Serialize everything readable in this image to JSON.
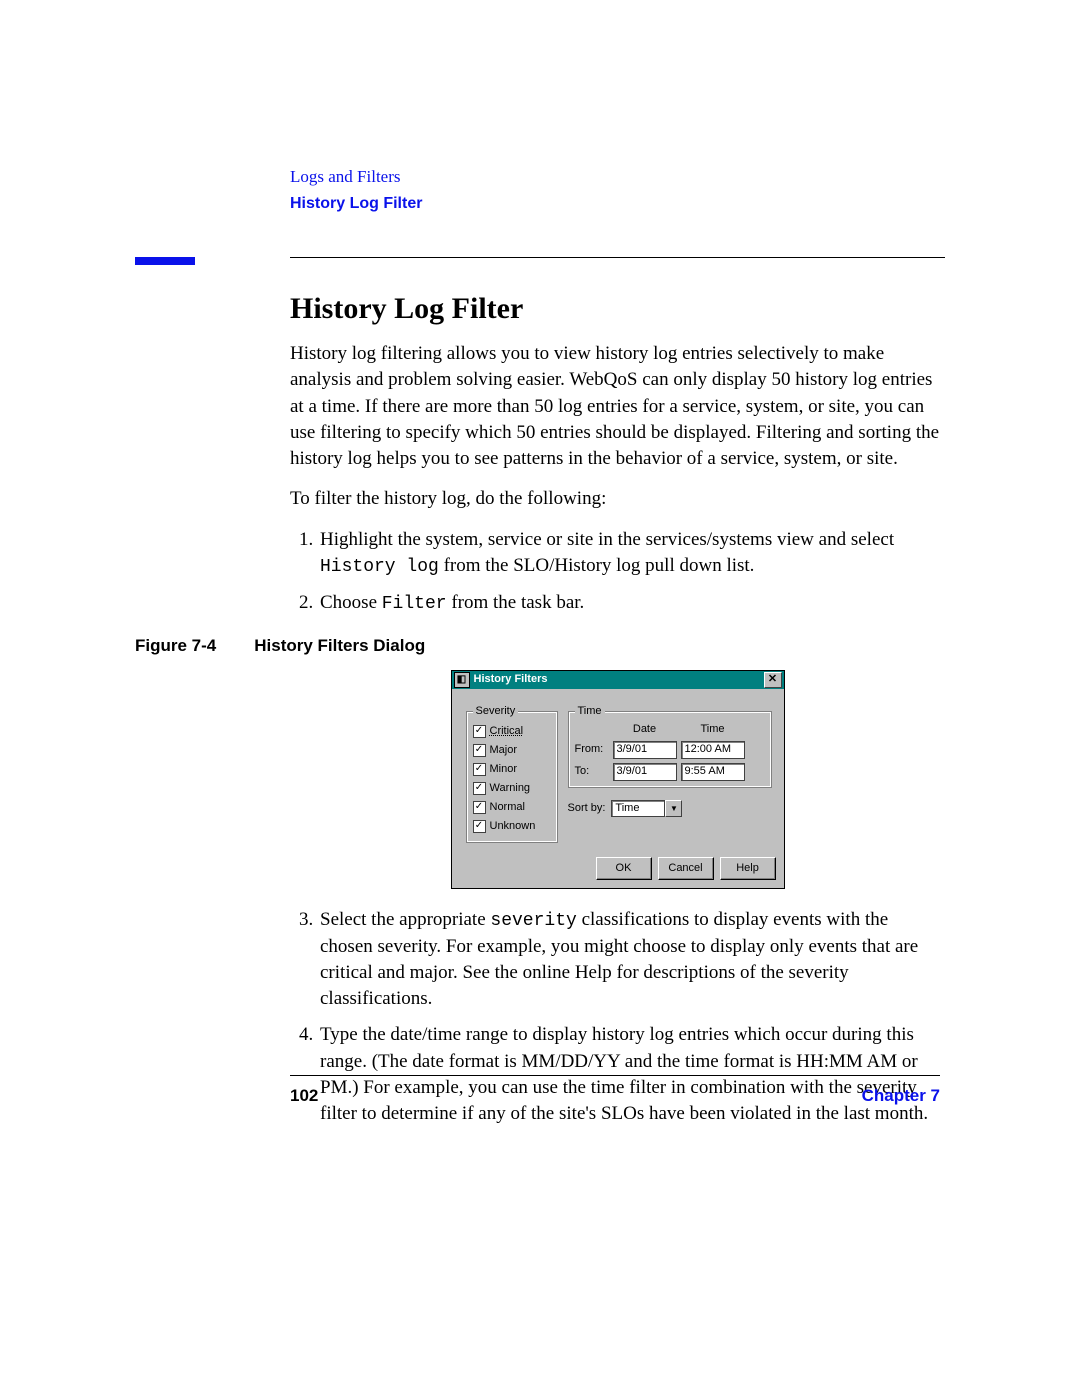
{
  "header": {
    "chapter": "Logs and Filters",
    "section": "History Log Filter"
  },
  "title": "History Log Filter",
  "para1": "History log filtering allows you to view history log entries selectively to make analysis and problem solving easier. WebQoS can only display 50 history log entries at a time. If there are more than 50 log entries for a service, system, or site, you can use filtering to specify which 50 entries should be displayed. Filtering and sorting the history log helps you to see patterns in the behavior of a service, system, or site.",
  "para2": "To filter the history log, do the following:",
  "step1a": "Highlight the system, service or site in the services/systems view and select ",
  "step1code": "History log",
  "step1b": " from the SLO/History log pull down list.",
  "step2a": "Choose ",
  "step2code": "Filter",
  "step2b": " from the task bar.",
  "figure": {
    "label": "Figure 7-4",
    "caption": "History Filters Dialog"
  },
  "dialog": {
    "title": "History Filters",
    "severity_legend": "Severity",
    "severities": [
      "Critical",
      "Major",
      "Minor",
      "Warning",
      "Normal",
      "Unknown"
    ],
    "time_legend": "Time",
    "date_hdr": "Date",
    "time_hdr": "Time",
    "from_label": "From:",
    "to_label": "To:",
    "from_date": "3/9/01",
    "from_time": "12:00 AM",
    "to_date": "3/9/01",
    "to_time": "9:55 AM",
    "sortby_label": "Sort by:",
    "sortby_value": "Time",
    "buttons": {
      "ok": "OK",
      "cancel": "Cancel",
      "help": "Help"
    }
  },
  "step3a": "Select the appropriate ",
  "step3code": "severity",
  "step3b": " classifications to display events with the chosen severity. For example, you might choose to display only events that are critical and major. See the online Help for descriptions of the severity classifications.",
  "step4": "Type the date/time range to display history log entries which occur during this range. (The date format is MM/DD/YY and the time format is HH:MM AM or PM.) For example, you can use the time filter in combination with the severity filter to determine if any of the site's SLOs have been violated in the last month.",
  "footer": {
    "page": "102",
    "chapter": "Chapter 7"
  }
}
